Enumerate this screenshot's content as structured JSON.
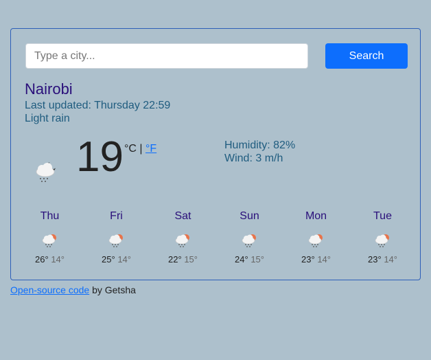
{
  "search": {
    "placeholder": "Type a city...",
    "button_label": "Search"
  },
  "current": {
    "city": "Nairobi",
    "updated_label": "Last updated:",
    "updated_time": "Thursday 22:59",
    "description": "Light rain",
    "temperature": "19",
    "unit_celsius": "°C",
    "unit_separator": "|",
    "unit_fahrenheit": "°F",
    "humidity_label": "Humidity:",
    "humidity_value": "82%",
    "wind_label": "Wind:",
    "wind_value": "3 m/h",
    "icon": "night-rain-cloud-icon"
  },
  "forecast": [
    {
      "day": "Thu",
      "max": "26°",
      "min": "14°",
      "icon": "sun-rain-cloud-icon"
    },
    {
      "day": "Fri",
      "max": "25°",
      "min": "14°",
      "icon": "sun-rain-cloud-icon"
    },
    {
      "day": "Sat",
      "max": "22°",
      "min": "15°",
      "icon": "sun-rain-cloud-icon"
    },
    {
      "day": "Sun",
      "max": "24°",
      "min": "15°",
      "icon": "sun-rain-cloud-icon"
    },
    {
      "day": "Mon",
      "max": "23°",
      "min": "14°",
      "icon": "sun-rain-cloud-icon"
    },
    {
      "day": "Tue",
      "max": "23°",
      "min": "14°",
      "icon": "sun-rain-cloud-icon"
    }
  ],
  "footer": {
    "link_text": "Open-source code",
    "suffix": "by Getsha"
  },
  "colors": {
    "background": "#adc0cc",
    "accent": "#0d6efd",
    "city": "#2a0f7a",
    "text": "#1f5c7f"
  }
}
